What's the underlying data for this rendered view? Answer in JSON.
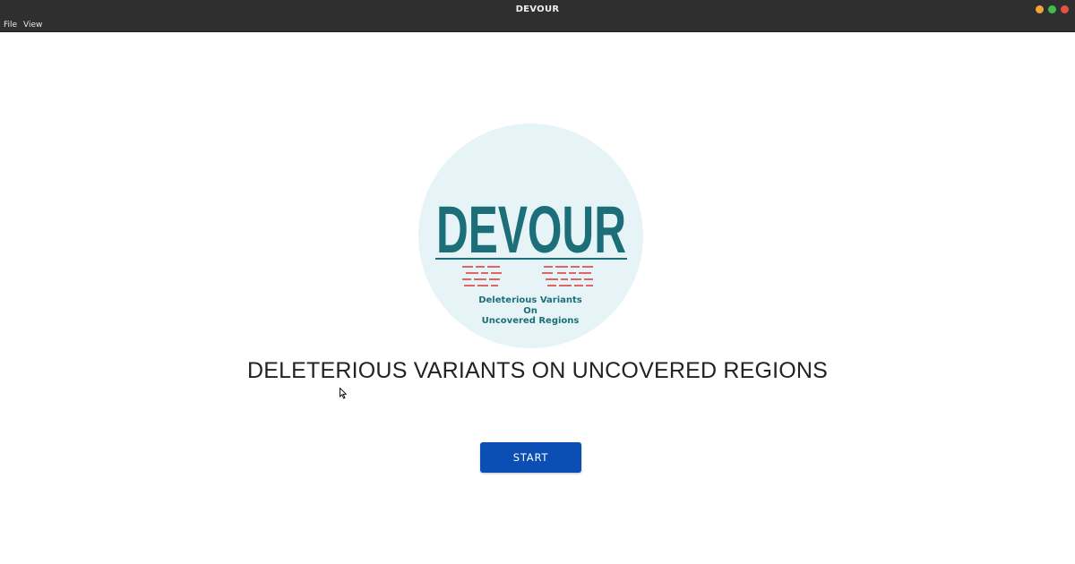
{
  "window": {
    "title": "DEVOUR"
  },
  "menubar": {
    "items": [
      "File",
      "View"
    ]
  },
  "logo": {
    "wordmark": "DEVOUR",
    "subtitle_lines": [
      "Deleterious Variants",
      "On",
      "Uncovered Regions"
    ],
    "colors": {
      "circle": "#e7f4f7",
      "wordmark": "#1c6f79",
      "dashes": "#e06464"
    }
  },
  "main": {
    "headline": "DELETERIOUS VARIANTS ON UNCOVERED REGIONS",
    "start_button": "START"
  },
  "colors": {
    "titlebar": "#2f2f2f",
    "accent_button": "#0b4fb5"
  }
}
